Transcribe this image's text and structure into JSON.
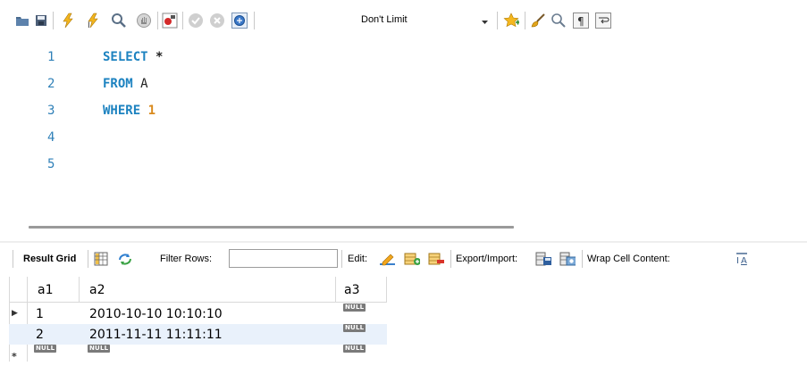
{
  "toolbar": {
    "limit_value": "Don't Limit",
    "icons": [
      "folder-open-icon",
      "save-icon",
      "execute-lightning-icon",
      "execute-current-icon",
      "explain-icon",
      "stop-icon",
      "toggle-error-icon",
      "commit-icon",
      "rollback-icon",
      "autocommit-icon",
      "add-snippet-star-icon",
      "beautify-brush-icon",
      "find-icon",
      "invisibles-icon",
      "word-wrap-icon"
    ]
  },
  "editor": {
    "lines": [
      {
        "no": "1",
        "keyword": "SELECT",
        "rest": "*",
        "rest_type": "op"
      },
      {
        "no": "2",
        "keyword": "FROM",
        "rest": "A",
        "rest_type": "ident"
      },
      {
        "no": "3",
        "keyword": "WHERE",
        "rest": "1",
        "rest_type": "num"
      },
      {
        "no": "4",
        "keyword": "",
        "rest": "",
        "rest_type": "ident"
      },
      {
        "no": "5",
        "keyword": "",
        "rest": "",
        "rest_type": "ident"
      }
    ]
  },
  "result_toolbar": {
    "result_grid_label": "Result Grid",
    "filter_rows_label": "Filter Rows:",
    "filter_value": "",
    "edit_label": "Edit:",
    "export_import_label": "Export/Import:",
    "wrap_label": "Wrap Cell Content:"
  },
  "grid": {
    "columns": [
      "a1",
      "a2",
      "a3"
    ],
    "rows": [
      {
        "a1": "1",
        "a2": "2010-10-10 10:10:10",
        "a3": "NULL",
        "marker": "▶"
      },
      {
        "a1": "2",
        "a2": "2011-11-11 11:11:11",
        "a3": "NULL",
        "marker": ""
      }
    ],
    "new_row": {
      "a1": "NULL",
      "a2": "NULL",
      "a3": "NULL",
      "marker": "*"
    }
  },
  "colors": {
    "keyword": "#1c82c0",
    "number": "#d98a1e",
    "line_number": "#2f80b8",
    "selected_row": "#e9f1fb"
  }
}
